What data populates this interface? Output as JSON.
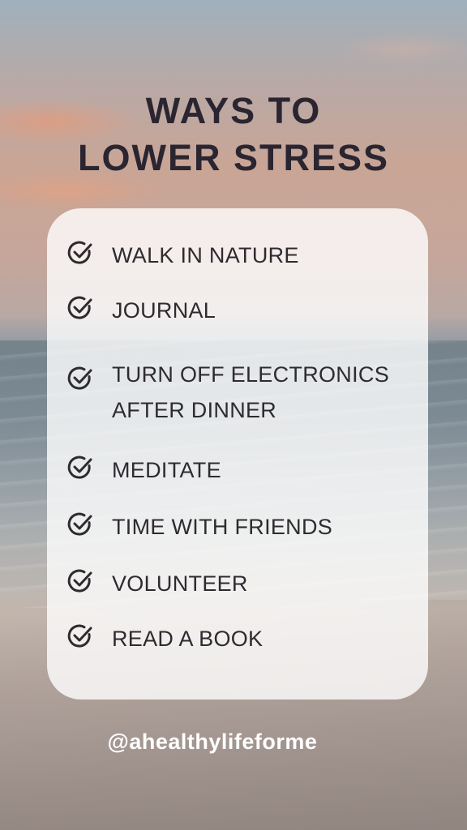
{
  "title": {
    "line1": "WAYS TO",
    "line2": "LOWER STRESS"
  },
  "items": [
    {
      "label": "WALK IN NATURE",
      "icon": "check-circle-icon"
    },
    {
      "label": "JOURNAL",
      "icon": "check-circle-icon"
    },
    {
      "label": "TURN OFF ELECTRONICS",
      "label2": "AFTER DINNER",
      "icon": "check-circle-icon"
    },
    {
      "label": "MEDITATE",
      "icon": "check-circle-icon"
    },
    {
      "label": "TIME WITH FRIENDS",
      "icon": "check-circle-icon"
    },
    {
      "label": "VOLUNTEER",
      "icon": "check-circle-icon"
    },
    {
      "label": "READ A BOOK",
      "icon": "check-circle-icon"
    }
  ],
  "handle": "@ahealthylifeforme",
  "colors": {
    "text": "#2e2b30",
    "card": "#ffffff",
    "handle": "#ffffff"
  }
}
